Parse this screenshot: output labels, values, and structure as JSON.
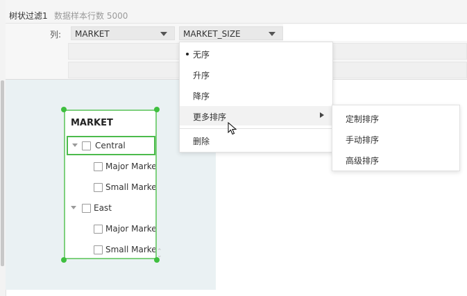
{
  "title_bar": {
    "name": "树状过滤1",
    "sample_info": "数据样本行数 5000"
  },
  "config": {
    "column_label": "列:",
    "dropdowns": [
      {
        "value": "MARKET"
      },
      {
        "value": "MARKET_SIZE"
      }
    ]
  },
  "tree": {
    "title": "MARKET",
    "rows": [
      {
        "label": "Central",
        "level": 0,
        "selected": true
      },
      {
        "label": "Major Marke",
        "level": 1
      },
      {
        "label": "Small Marke",
        "level": 1
      },
      {
        "label": "East",
        "level": 0
      },
      {
        "label": "Major Marke",
        "level": 1
      },
      {
        "label": "Small Marke",
        "level": 1
      }
    ]
  },
  "context_menu": {
    "items": [
      {
        "label": "无序",
        "checked": true
      },
      {
        "label": "升序"
      },
      {
        "label": "降序"
      },
      {
        "label": "更多排序",
        "has_submenu": true,
        "hovered": true
      },
      {
        "label": "删除"
      }
    ]
  },
  "submenu": {
    "items": [
      {
        "label": "定制排序"
      },
      {
        "label": "手动排序"
      },
      {
        "label": "高级排序"
      }
    ]
  },
  "colors": {
    "accent_green": "#3fbf3f",
    "canvas_bg": "#eaf1f3"
  }
}
